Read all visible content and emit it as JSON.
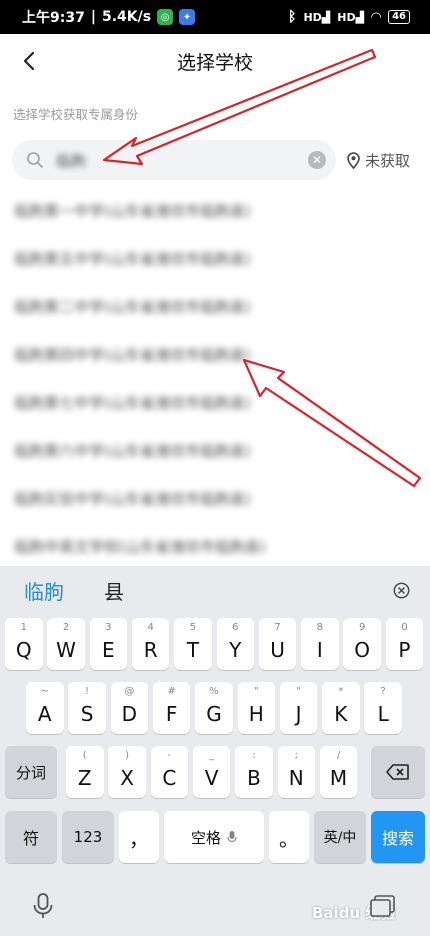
{
  "status_bar": {
    "time": "上午9:37",
    "speed": "5.4K/s",
    "signal1": "HD",
    "signal2": "HD",
    "battery": "46"
  },
  "header": {
    "title": "选择学校"
  },
  "subtitle": "选择学校获取专属身份",
  "search": {
    "value": "临朐"
  },
  "location_text": "未获取",
  "results": [
    "临朐第一中学(山东省潍坊市临朐县)",
    "临朐第五中学(山东省潍坊市临朐县)",
    "临朐第二中学(山东省潍坊市临朐县)",
    "临朐第四中学(山东省潍坊市临朐县)",
    "临朐第七中学(山东省潍坊市临朐县)",
    "临朐第六中学(山东省潍坊市临朐县)",
    "临朐实验中学(山东省潍坊市临朐县)",
    "临朐中英文学校(山东省潍坊市临朐县)"
  ],
  "keyboard": {
    "candidates": [
      "临朐",
      "县"
    ],
    "row1": [
      {
        "k": "Q",
        "s": "1"
      },
      {
        "k": "W",
        "s": "2"
      },
      {
        "k": "E",
        "s": "3"
      },
      {
        "k": "R",
        "s": "4"
      },
      {
        "k": "T",
        "s": "5"
      },
      {
        "k": "Y",
        "s": "6"
      },
      {
        "k": "U",
        "s": "7"
      },
      {
        "k": "I",
        "s": "8"
      },
      {
        "k": "O",
        "s": "9"
      },
      {
        "k": "P",
        "s": "0"
      }
    ],
    "row2": [
      {
        "k": "A",
        "s": "~"
      },
      {
        "k": "S",
        "s": "!"
      },
      {
        "k": "D",
        "s": "@"
      },
      {
        "k": "F",
        "s": "#"
      },
      {
        "k": "G",
        "s": "%"
      },
      {
        "k": "H",
        "s": "\""
      },
      {
        "k": "J",
        "s": "\""
      },
      {
        "k": "K",
        "s": "*"
      },
      {
        "k": "L",
        "s": "?"
      }
    ],
    "row3": [
      {
        "k": "Z",
        "s": "("
      },
      {
        "k": "X",
        "s": ")"
      },
      {
        "k": "C",
        "s": "-"
      },
      {
        "k": "V",
        "s": "_"
      },
      {
        "k": "B",
        "s": ":"
      },
      {
        "k": "N",
        "s": ";"
      },
      {
        "k": "M",
        "s": "/"
      }
    ],
    "fenci": "分词",
    "fu": "符",
    "num": "123",
    "comma": "，",
    "space": "空格",
    "period": "。",
    "lang": "英/中",
    "search": "搜索"
  },
  "watermark": "Baidu 经验",
  "colors": {
    "accent": "#1e8ee0",
    "search_key": "#2196f3",
    "arrow": "#d8232a"
  }
}
